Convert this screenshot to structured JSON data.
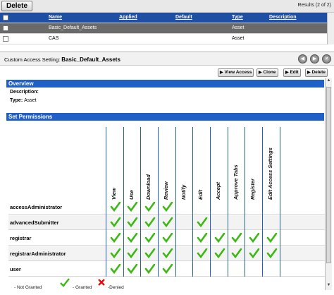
{
  "toolbar": {
    "delete_label": "Delete",
    "results": "Results (2 of 2)"
  },
  "asset_table": {
    "columns": [
      "Name",
      "Applied",
      "Default",
      "Type",
      "Description"
    ],
    "rows": [
      {
        "name": "Basic_Default_Assets",
        "type": "Asset",
        "selected": true
      },
      {
        "name": "CAS",
        "type": "Asset",
        "selected": false
      }
    ]
  },
  "detail": {
    "label": "Custom Access Setting:",
    "name": "Basic_Default_Assets",
    "actions": [
      "View Access",
      "Clone",
      "Edit",
      "Delete"
    ]
  },
  "overview": {
    "title": "Overview",
    "description_label": "Description:",
    "description": "",
    "type_label": "Type:",
    "type": "Asset"
  },
  "permissions": {
    "title": "Set Permissions",
    "columns": [
      "View",
      "Use",
      "Download",
      "Review",
      "Notify",
      "Edit",
      "Accept",
      "Approve Tabs",
      "Register",
      "Edit Access Settings"
    ],
    "rows": [
      {
        "user": "accessAdministrator",
        "granted": [
          true,
          true,
          true,
          true,
          false,
          false,
          false,
          false,
          false,
          false
        ]
      },
      {
        "user": "advancedSubmitter",
        "granted": [
          true,
          true,
          true,
          true,
          false,
          true,
          false,
          false,
          false,
          false
        ]
      },
      {
        "user": "registrar",
        "granted": [
          true,
          true,
          true,
          true,
          false,
          true,
          true,
          true,
          true,
          true
        ]
      },
      {
        "user": "registrarAdministrator",
        "granted": [
          true,
          true,
          true,
          true,
          false,
          true,
          true,
          true,
          true,
          true
        ]
      },
      {
        "user": "user",
        "granted": [
          true,
          true,
          true,
          true,
          false,
          false,
          false,
          false,
          false,
          false
        ]
      }
    ]
  },
  "legend": {
    "not_granted": "- Not Granted",
    "granted": "- Granted",
    "denied": "-Denied"
  },
  "colors": {
    "header_blue": "#1f4fa3",
    "section_blue": "#1f5fc8",
    "check_green": "#3cb814",
    "deny_red": "#e01010"
  }
}
